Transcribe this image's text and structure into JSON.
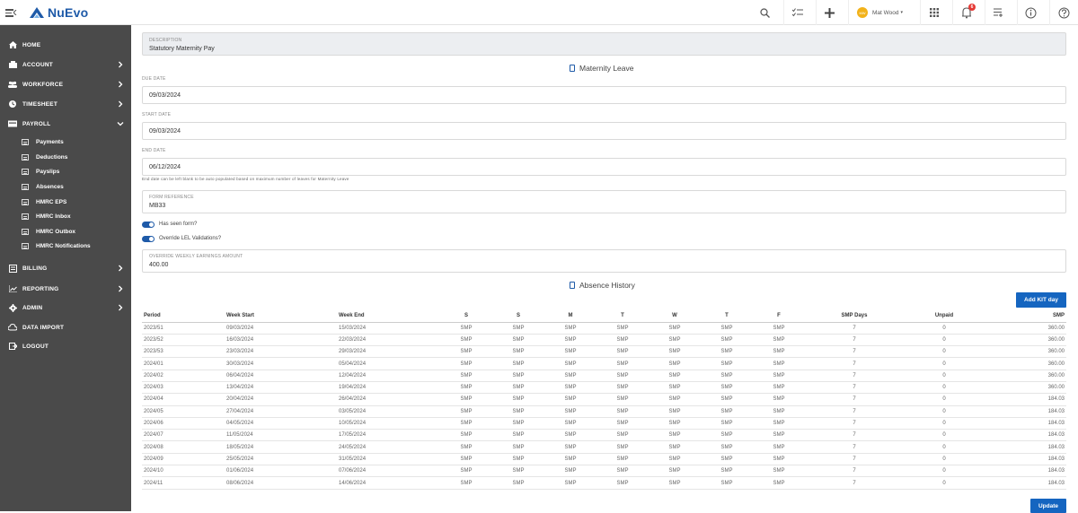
{
  "brand": {
    "name": "NuEvo"
  },
  "topbar": {
    "user_name": "Mat Wood",
    "user_initials": "MW",
    "notifications_count": "6"
  },
  "sidebar": {
    "items": [
      {
        "label": "HOME"
      },
      {
        "label": "ACCOUNT"
      },
      {
        "label": "WORKFORCE"
      },
      {
        "label": "TIMESHEET"
      },
      {
        "label": "PAYROLL"
      }
    ],
    "payroll_items": [
      {
        "label": "Payments"
      },
      {
        "label": "Deductions"
      },
      {
        "label": "Payslips"
      },
      {
        "label": "Absences"
      },
      {
        "label": "HMRC EPS"
      },
      {
        "label": "HMRC Inbox"
      },
      {
        "label": "HMRC Outbox"
      },
      {
        "label": "HMRC Notifications"
      }
    ],
    "bottom_items": [
      {
        "label": "BILLING"
      },
      {
        "label": "REPORTING"
      },
      {
        "label": "ADMIN"
      },
      {
        "label": "DATA IMPORT"
      },
      {
        "label": "LOGOUT"
      }
    ]
  },
  "form": {
    "description_label": "DESCRIPTION",
    "description_value": "Statutory Maternity Pay",
    "section_title": "Maternity Leave",
    "due_date_label": "DUE DATE",
    "due_date_value": "09/03/2024",
    "start_date_label": "START DATE",
    "start_date_value": "09/03/2024",
    "end_date_label": "END DATE",
    "end_date_value": "06/12/2024",
    "end_date_hint": "End date can be left blank to be auto populated based on maximum number of leaves for Maternity Leave",
    "form_ref_label": "FORM REFERENCE",
    "form_ref_value": "MB33",
    "toggle1_label": "Has seen form?",
    "toggle2_label": "Override LEL Validations?",
    "override_label": "OVERRIDE WEEKLY EARNINGS AMOUNT",
    "override_value": "400.00"
  },
  "history": {
    "title": "Absence History",
    "add_kit_label": "Add KIT day",
    "update_label": "Update",
    "columns": [
      "Period",
      "Week Start",
      "Week End",
      "S",
      "S",
      "M",
      "T",
      "W",
      "T",
      "F",
      "SMP Days",
      "Unpaid",
      "SMP"
    ],
    "rows": [
      [
        "2023/51",
        "09/03/2024",
        "15/03/2024",
        "SMP",
        "SMP",
        "SMP",
        "SMP",
        "SMP",
        "SMP",
        "SMP",
        "7",
        "0",
        "360.00"
      ],
      [
        "2023/52",
        "16/03/2024",
        "22/03/2024",
        "SMP",
        "SMP",
        "SMP",
        "SMP",
        "SMP",
        "SMP",
        "SMP",
        "7",
        "0",
        "360.00"
      ],
      [
        "2023/53",
        "23/03/2024",
        "29/03/2024",
        "SMP",
        "SMP",
        "SMP",
        "SMP",
        "SMP",
        "SMP",
        "SMP",
        "7",
        "0",
        "360.00"
      ],
      [
        "2024/01",
        "30/03/2024",
        "05/04/2024",
        "SMP",
        "SMP",
        "SMP",
        "SMP",
        "SMP",
        "SMP",
        "SMP",
        "7",
        "0",
        "360.00"
      ],
      [
        "2024/02",
        "06/04/2024",
        "12/04/2024",
        "SMP",
        "SMP",
        "SMP",
        "SMP",
        "SMP",
        "SMP",
        "SMP",
        "7",
        "0",
        "360.00"
      ],
      [
        "2024/03",
        "13/04/2024",
        "19/04/2024",
        "SMP",
        "SMP",
        "SMP",
        "SMP",
        "SMP",
        "SMP",
        "SMP",
        "7",
        "0",
        "360.00"
      ],
      [
        "2024/04",
        "20/04/2024",
        "26/04/2024",
        "SMP",
        "SMP",
        "SMP",
        "SMP",
        "SMP",
        "SMP",
        "SMP",
        "7",
        "0",
        "184.03"
      ],
      [
        "2024/05",
        "27/04/2024",
        "03/05/2024",
        "SMP",
        "SMP",
        "SMP",
        "SMP",
        "SMP",
        "SMP",
        "SMP",
        "7",
        "0",
        "184.03"
      ],
      [
        "2024/06",
        "04/05/2024",
        "10/05/2024",
        "SMP",
        "SMP",
        "SMP",
        "SMP",
        "SMP",
        "SMP",
        "SMP",
        "7",
        "0",
        "184.03"
      ],
      [
        "2024/07",
        "11/05/2024",
        "17/05/2024",
        "SMP",
        "SMP",
        "SMP",
        "SMP",
        "SMP",
        "SMP",
        "SMP",
        "7",
        "0",
        "184.03"
      ],
      [
        "2024/08",
        "18/05/2024",
        "24/05/2024",
        "SMP",
        "SMP",
        "SMP",
        "SMP",
        "SMP",
        "SMP",
        "SMP",
        "7",
        "0",
        "184.03"
      ],
      [
        "2024/09",
        "25/05/2024",
        "31/05/2024",
        "SMP",
        "SMP",
        "SMP",
        "SMP",
        "SMP",
        "SMP",
        "SMP",
        "7",
        "0",
        "184.03"
      ],
      [
        "2024/10",
        "01/06/2024",
        "07/06/2024",
        "SMP",
        "SMP",
        "SMP",
        "SMP",
        "SMP",
        "SMP",
        "SMP",
        "7",
        "0",
        "184.03"
      ],
      [
        "2024/11",
        "08/06/2024",
        "14/06/2024",
        "SMP",
        "SMP",
        "SMP",
        "SMP",
        "SMP",
        "SMP",
        "SMP",
        "7",
        "0",
        "184.03"
      ]
    ]
  },
  "colors": {
    "brand": "#1e5aa8",
    "sidebar": "#4a4a4a",
    "button": "#1565c0",
    "badge": "#e53935"
  }
}
